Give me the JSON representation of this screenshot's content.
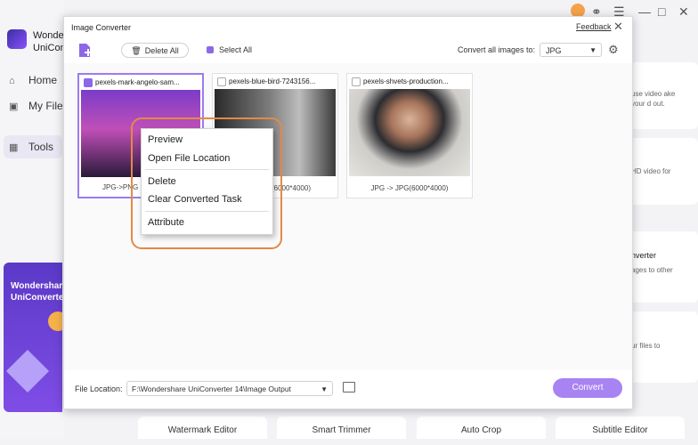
{
  "brand": {
    "line1": "Wonder",
    "line2": "UniCon"
  },
  "nav": [
    {
      "label": "Home",
      "icon": "home-icon"
    },
    {
      "label": "My File",
      "icon": "folder-icon"
    },
    {
      "label": "Tools",
      "icon": "tools-icon"
    }
  ],
  "promo": {
    "text": "Wondershare UniConverter"
  },
  "bg_cards": {
    "card1": "use video ake your d out.",
    "card2": "HD video for",
    "card3_title": "nverter",
    "card3_text": "ages to other",
    "card4": "ur files to"
  },
  "bottom_tools": [
    "Watermark Editor",
    "Smart Trimmer",
    "Auto Crop",
    "Subtitle Editor"
  ],
  "dialog": {
    "title": "Image Converter",
    "feedback": "Feedback",
    "delete_all": "Delete All",
    "select_all": "Select All",
    "convert_all_label": "Convert all images to:",
    "format": "JPG",
    "file_location_label": "File Location:",
    "file_location": "F:\\Wondershare UniConverter 14\\Image Output",
    "convert": "Convert"
  },
  "images": [
    {
      "name": "pexels-mark-angelo-sam...",
      "status": "JPG->PNG",
      "checked": true
    },
    {
      "name": "pexels-blue-bird-7243156...",
      "status": "(6000*4000)",
      "checked": false
    },
    {
      "name": "pexels-shvets-production...",
      "status": "JPG -> JPG(6000*4000)",
      "checked": false
    }
  ],
  "context_menu": [
    "Preview",
    "Open File Location",
    "Delete",
    "Clear Converted Task",
    "Attribute"
  ],
  "colors": {
    "accent": "#8d67e8",
    "convert_button": "#a883f2",
    "highlight": "#e48a45"
  }
}
